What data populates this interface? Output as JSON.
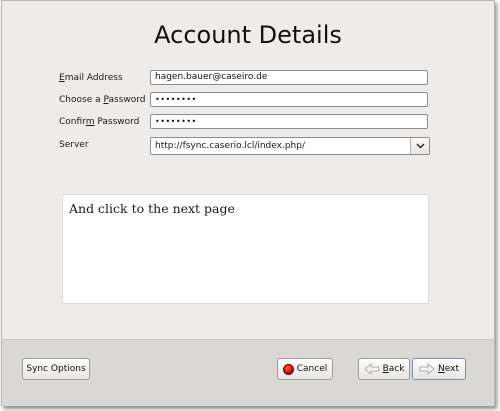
{
  "dialog": {
    "title": "Account Details"
  },
  "form": {
    "email_label_accel": "E",
    "email_label_rest": "mail Address",
    "email_value": "hagen.bauer@caseiro.de",
    "password_label_pre": "Choose a ",
    "password_label_accel": "P",
    "password_label_post": "assword",
    "password_value": "••••••••",
    "confirm_label_pre": "Confir",
    "confirm_label_accel": "m",
    "confirm_label_post": " Password",
    "confirm_value": "••••••••",
    "server_label": "Server",
    "server_value": "http://fsync.caserio.lcl/index.php/"
  },
  "message": {
    "text": "And click to the next page"
  },
  "buttons": {
    "sync_options": "Sync Options",
    "cancel": "Cancel",
    "back_accel": "B",
    "back_rest": "ack",
    "next_accel": "N",
    "next_rest": "ext"
  }
}
